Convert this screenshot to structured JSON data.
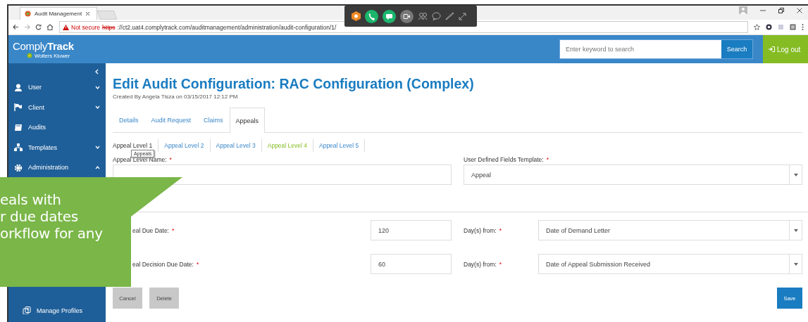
{
  "browser": {
    "tab_title": "Audit Management",
    "not_secure": "Not secure",
    "url_scheme": "https",
    "url_rest": "://ct2.uat4.complytrack.com/auditmanagement/administration/audit-configuration/1/"
  },
  "header": {
    "logo": "Comply**Track**",
    "brand": "Wolters Kluwer",
    "search": {
      "placeholder": "Enter keyword to search"
    },
    "search_button": "Search",
    "logout": "Log out"
  },
  "sidebar": {
    "items": [
      {
        "label": "User",
        "expanded": false
      },
      {
        "label": "Client",
        "expanded": false
      },
      {
        "label": "Audits"
      },
      {
        "label": "Templates",
        "expanded": false
      },
      {
        "label": "Administration",
        "expanded": true,
        "children": [
          {
            "label": "Manage Profiles"
          }
        ]
      }
    ]
  },
  "page": {
    "title": "Edit Audit Configuration: RAC Configuration (Complex)",
    "created_by": "Created By Angela Tisza on 03/15/2017 12:12 PM",
    "tabs": [
      {
        "label": "Details",
        "selected": false
      },
      {
        "label": "Audit Request",
        "selected": false
      },
      {
        "label": "Claims",
        "selected": false
      },
      {
        "label": "Appeals",
        "selected": true
      }
    ],
    "level_tabs": [
      {
        "label": "Appeal Level 1",
        "selected": true,
        "hovered": false
      },
      {
        "label": "Appeal Level 2",
        "selected": false,
        "hovered": false
      },
      {
        "label": "Appeal Level 3",
        "selected": false,
        "hovered": false
      },
      {
        "label": "Appeal Level 4",
        "selected": false,
        "hovered": true
      },
      {
        "label": "Appeal Level 5",
        "selected": false,
        "hovered": false
      }
    ],
    "tooltip": "Appeals",
    "level_name": {
      "label": "Appeal Level Name:",
      "required": "*"
    },
    "udf_template": {
      "label": "User Defined Fields Template:",
      "required": "*",
      "value": "Appeal"
    },
    "rules": [
      {
        "label": "eal Due Date:",
        "required": "*",
        "days": "120",
        "from_label": "Day(s) from:",
        "from_required": "*",
        "from_value": "Date of Demand Letter"
      },
      {
        "label": "eal Decision Due Date:",
        "required": "*",
        "days": "60",
        "from_label": "Day(s) from:",
        "from_required": "*",
        "from_value": "Date of Appeal Submission Received"
      }
    ],
    "buttons": {
      "cancel": "Cancel",
      "delete": "Delete",
      "save": "Save"
    }
  },
  "callout": {
    "lines": [
      "eals with",
      "r due dates",
      "orkflow for any"
    ]
  }
}
